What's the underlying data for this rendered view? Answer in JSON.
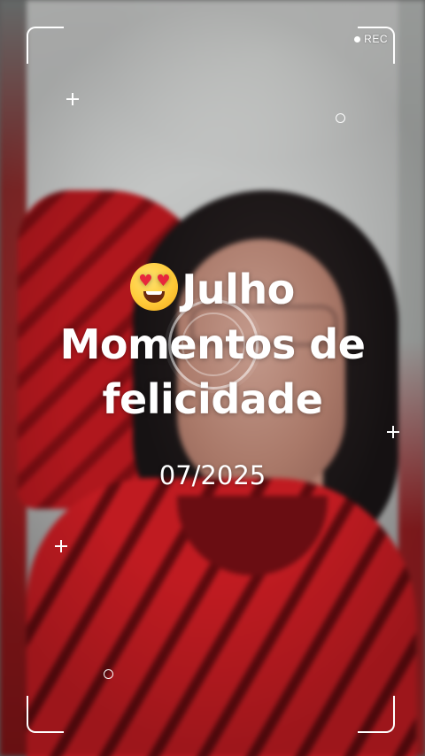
{
  "recording": {
    "label": "REC"
  },
  "overlay": {
    "title_line1": "Julho",
    "title_line2": "Momentos de",
    "title_line3": "felicidade",
    "date": "07/2025",
    "emoji": "heart-eyes-emoji"
  },
  "colors": {
    "frame_lines": "#ffffff",
    "text": "#ffffff",
    "sweater_red": "#b5181e"
  }
}
